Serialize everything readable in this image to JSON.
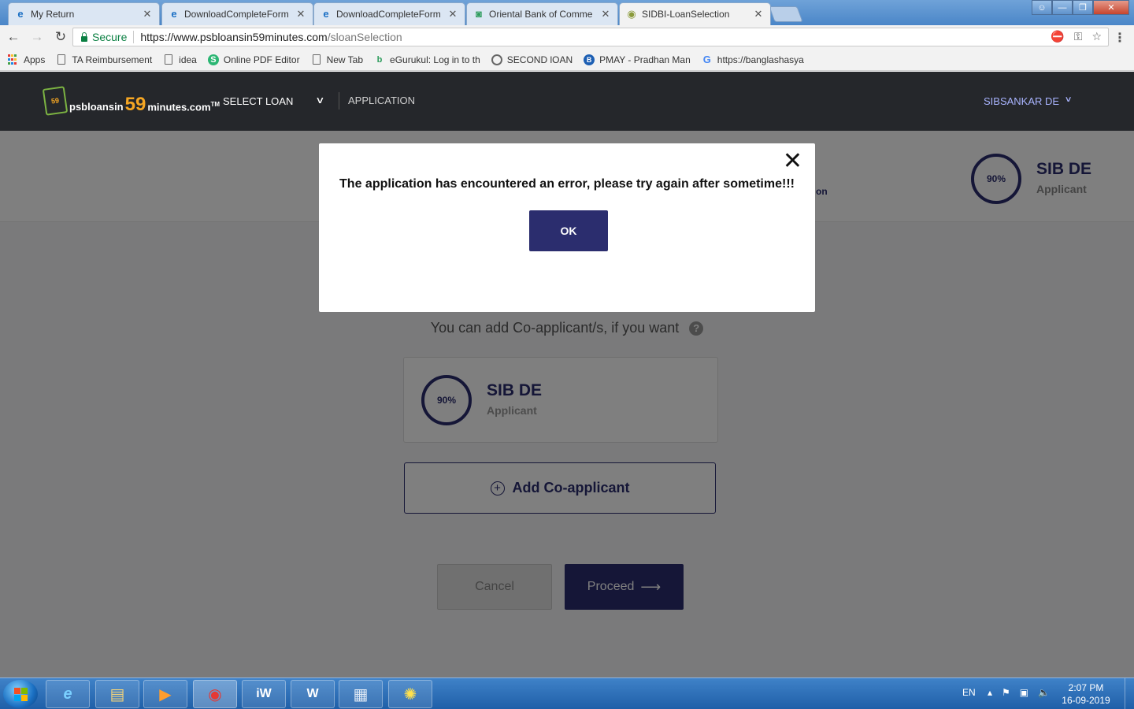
{
  "browser": {
    "tabs": [
      {
        "title": "My Return",
        "icon": "ie-icon",
        "active": false
      },
      {
        "title": "DownloadCompleteForm",
        "icon": "ie-icon",
        "active": false
      },
      {
        "title": "DownloadCompleteForm",
        "icon": "ie-icon",
        "active": false
      },
      {
        "title": "Oriental Bank of Comme",
        "icon": "obc-icon",
        "active": false
      },
      {
        "title": "SIDBI-LoanSelection",
        "icon": "sidbi-icon",
        "active": true
      }
    ],
    "close_glyph": "✕",
    "secure_label": "Secure",
    "url_host": "https://www.psbloansin59minutes.com",
    "url_path": "/sloanSelection"
  },
  "bookmarks": [
    {
      "label": "Apps",
      "icon": "apps-grid-icon"
    },
    {
      "label": "TA Reimbursement",
      "icon": "page-icon"
    },
    {
      "label": "idea",
      "icon": "page-icon"
    },
    {
      "label": "Online PDF Editor",
      "icon": "s-icon"
    },
    {
      "label": "New Tab",
      "icon": "page-icon"
    },
    {
      "label": "eGurukul: Log in to th",
      "icon": "egurukul-icon"
    },
    {
      "label": "SECOND lOAN",
      "icon": "camera-icon"
    },
    {
      "label": "PMAY - Pradhan Man",
      "icon": "pmay-icon"
    },
    {
      "label": "https://banglashasya",
      "icon": "google-icon"
    }
  ],
  "site": {
    "logo_prefix": "psbloansin",
    "logo_num": "59",
    "logo_suffix": "minutes.com",
    "logo_tm": "TM",
    "nav_select_loan": "SELECT LOAN",
    "nav_application": "APPLICATION",
    "user_name": "SIBSANKAR DE"
  },
  "profile": {
    "progress": "90%",
    "progress_value": 0.9,
    "name": "SIB DE",
    "role": "Applicant",
    "strip_fragment": "on"
  },
  "coapplicant": {
    "hint": "You can add Co-applicant/s, if you want",
    "add_label": "Add Co-applicant"
  },
  "actions": {
    "cancel": "Cancel",
    "proceed": "Proceed"
  },
  "modal": {
    "message": "The application has encountered an error, please try again after sometime!!!",
    "ok": "OK"
  },
  "taskbar": {
    "lang": "EN",
    "time": "2:07 PM",
    "date": "16-09-2019",
    "items": [
      "ie-icon",
      "explorer-icon",
      "media-player-icon",
      "chrome-icon",
      "iw-icon",
      "word-icon",
      "calculator-icon",
      "app-icon"
    ]
  },
  "colors": {
    "brand": "#2b2d6e",
    "header_bg": "#25272b",
    "logo_accent": "#f5a623"
  }
}
